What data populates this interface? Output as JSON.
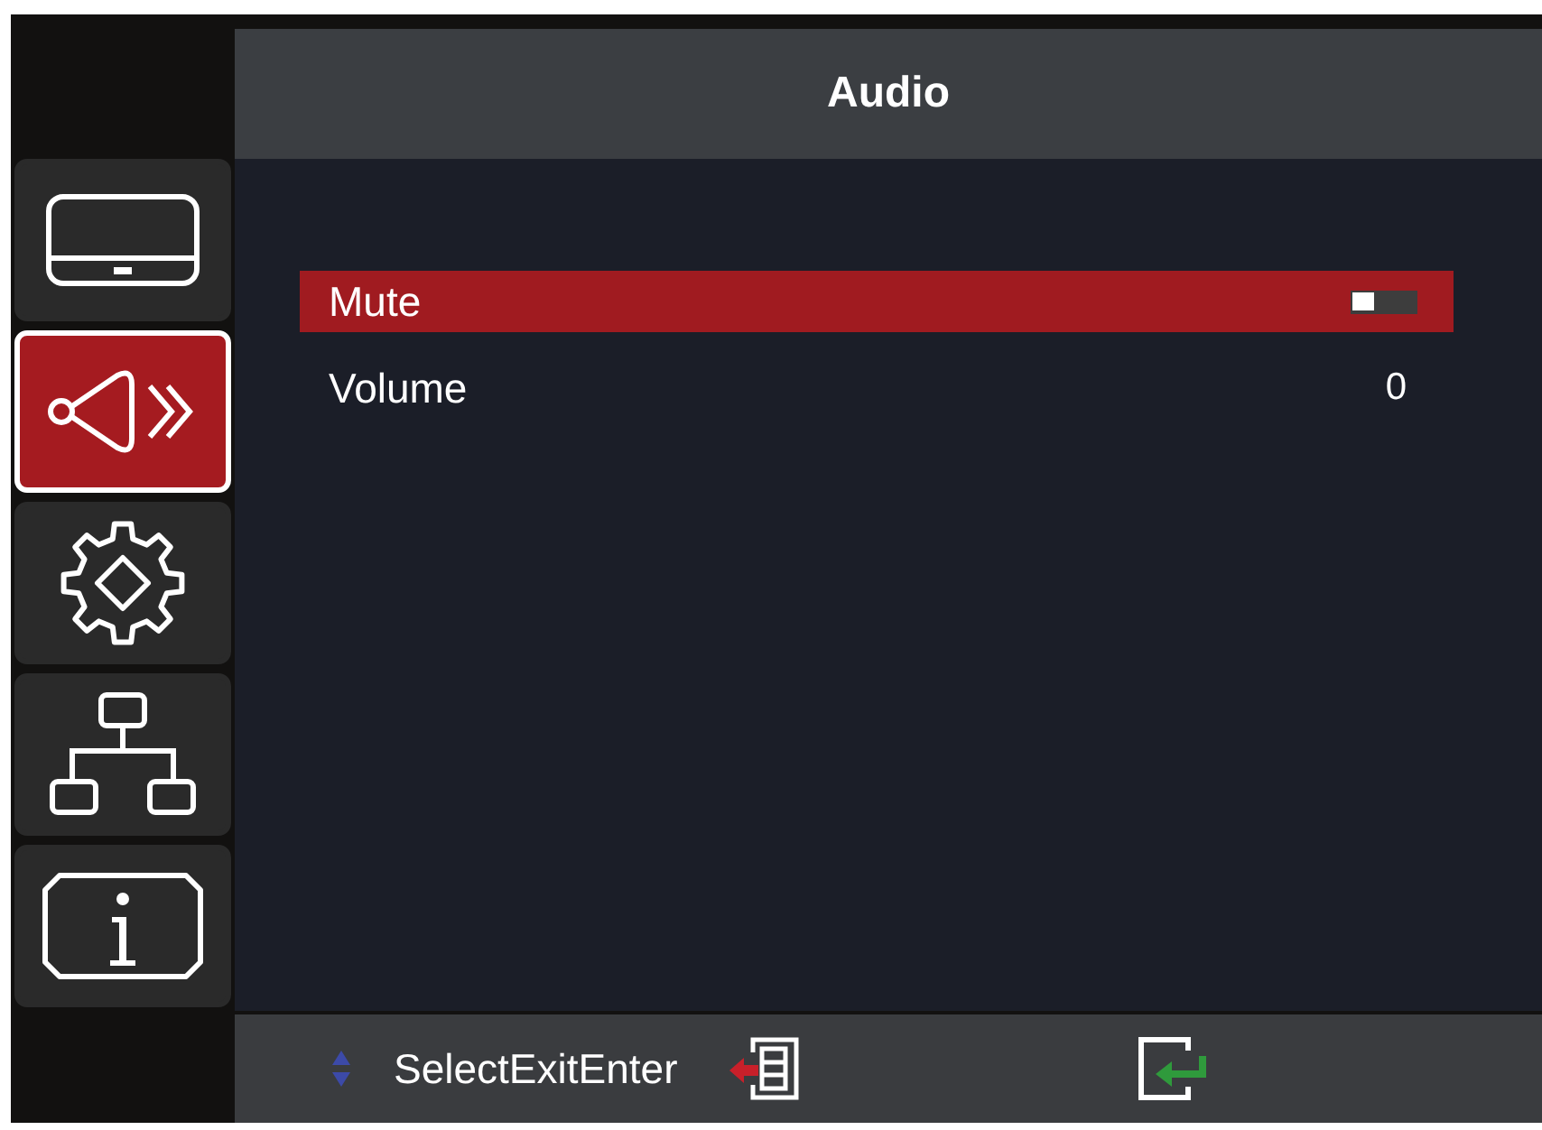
{
  "header": {
    "title": "Audio"
  },
  "sidebar": {
    "items": [
      {
        "kind": "display",
        "selected": false
      },
      {
        "kind": "audio",
        "selected": true
      },
      {
        "kind": "settings",
        "selected": false
      },
      {
        "kind": "network",
        "selected": false
      },
      {
        "kind": "info",
        "selected": false
      }
    ]
  },
  "menu": {
    "rows": [
      {
        "kind": "toggle",
        "label": "Mute",
        "selected": true,
        "on": false
      },
      {
        "kind": "value",
        "label": "Volume",
        "selected": false,
        "value": "0"
      }
    ]
  },
  "footer": {
    "hint": "SelectExitEnter"
  }
}
